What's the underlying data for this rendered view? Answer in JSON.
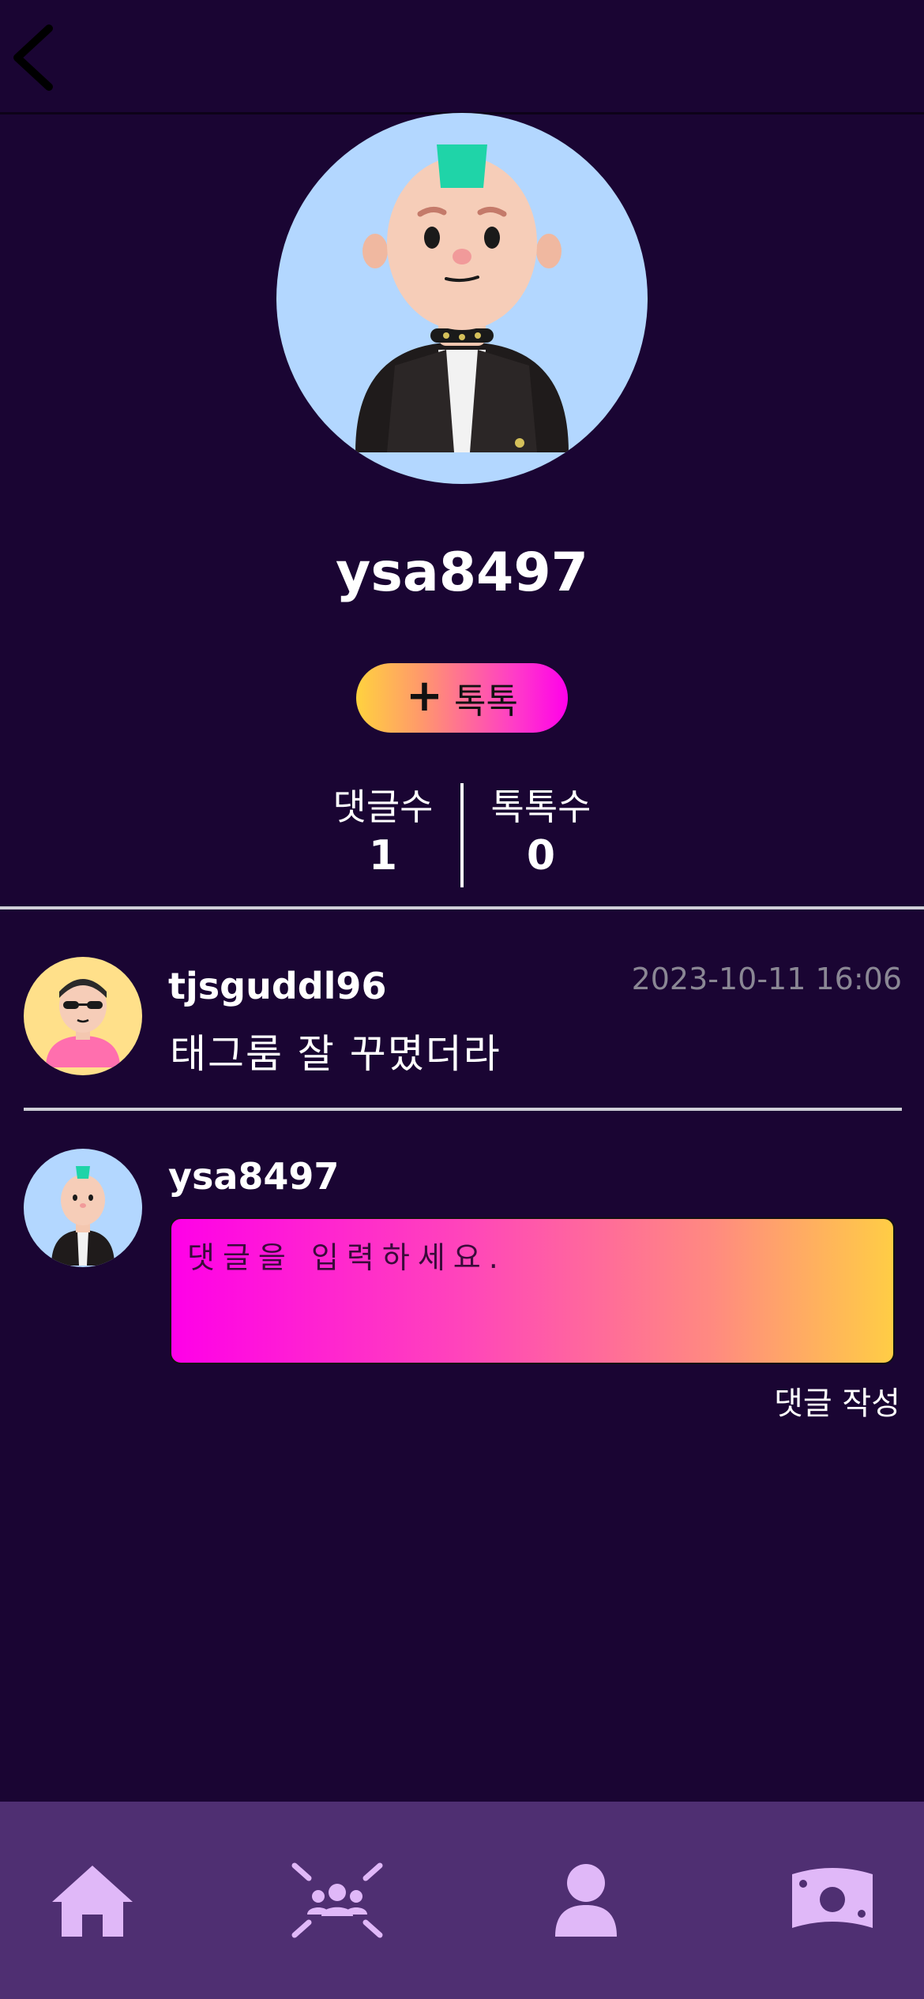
{
  "profile": {
    "username": "ysa8497",
    "follow_button": {
      "icon": "plus-icon",
      "label": "톡톡"
    },
    "stats": [
      {
        "label": "댓글수",
        "value": "1"
      },
      {
        "label": "톡톡수",
        "value": "0"
      }
    ]
  },
  "comments": [
    {
      "author": "tjsguddl96",
      "timestamp": "2023-10-11 16:06",
      "text": "태그룸 잘 꾸몄더라"
    }
  ],
  "compose": {
    "author": "ysa8497",
    "placeholder": "댓글을 입력하세요.",
    "submit_label": "댓글 작성"
  },
  "nav": {
    "items": [
      {
        "icon": "home-icon"
      },
      {
        "icon": "community-icon"
      },
      {
        "icon": "profile-icon"
      },
      {
        "icon": "money-icon"
      }
    ]
  },
  "colors": {
    "background": "#1a0533",
    "nav_background": "#4f2f72",
    "nav_icon": "#e0b8f8",
    "avatar_background": "#b3d7ff",
    "commenter_avatar_background": "#ffe08a"
  }
}
